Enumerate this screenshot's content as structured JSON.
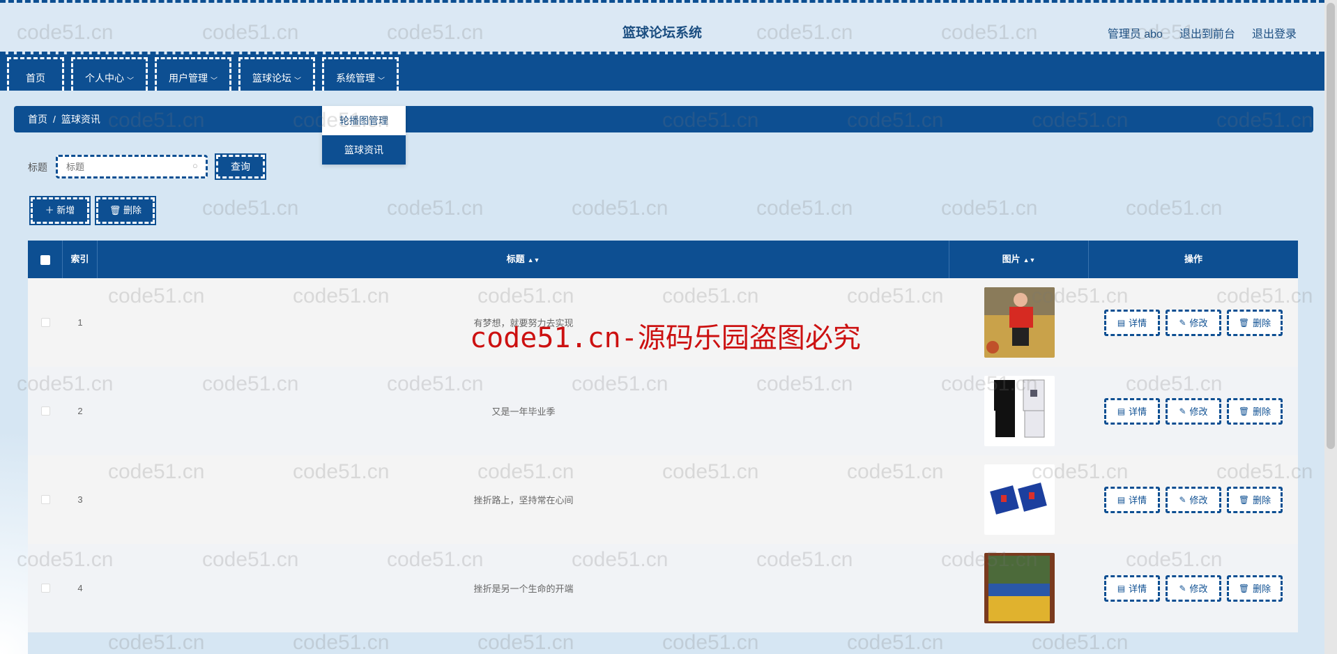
{
  "header": {
    "title": "篮球论坛系统",
    "user_label": "管理员 abo",
    "frontend_link": "退出到前台",
    "logout_link": "退出登录"
  },
  "nav": {
    "home": "首页",
    "personal": "个人中心",
    "users": "用户管理",
    "forum": "篮球论坛",
    "system": "系统管理"
  },
  "dropdown": {
    "item1": "轮播图管理",
    "item2": "篮球资讯"
  },
  "breadcrumb": {
    "home": "首页",
    "sep": "/",
    "current": "篮球资讯"
  },
  "search": {
    "label": "标题",
    "placeholder": "标题",
    "button": "查询"
  },
  "actions": {
    "add": "新增",
    "delete": "删除"
  },
  "table": {
    "headers": {
      "index": "索引",
      "title": "标题",
      "image": "图片",
      "ops": "操作"
    },
    "ops": {
      "detail": "详情",
      "edit": "修改",
      "delete": "删除"
    },
    "rows": [
      {
        "index": "1",
        "title": "有梦想，就要努力去实现"
      },
      {
        "index": "2",
        "title": "又是一年毕业季"
      },
      {
        "index": "3",
        "title": "挫折路上，坚持常在心间"
      },
      {
        "index": "4",
        "title": "挫折是另一个生命的开端"
      }
    ]
  },
  "watermark": {
    "text": "code51.cn",
    "red": "code51.cn-源码乐园盗图必究"
  }
}
